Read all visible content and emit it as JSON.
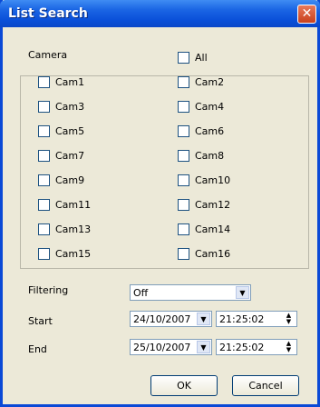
{
  "window": {
    "title": "List Search",
    "close_glyph": "✕"
  },
  "camera": {
    "label": "Camera",
    "all_label": "All",
    "cams": [
      "Cam1",
      "Cam2",
      "Cam3",
      "Cam4",
      "Cam5",
      "Cam6",
      "Cam7",
      "Cam8",
      "Cam9",
      "Cam10",
      "Cam11",
      "Cam12",
      "Cam13",
      "Cam14",
      "Cam15",
      "Cam16"
    ]
  },
  "filtering": {
    "label": "Filtering",
    "value": "Off"
  },
  "start": {
    "label": "Start",
    "date": "24/10/2007",
    "time": "21:25:02"
  },
  "end": {
    "label": "End",
    "date": "25/10/2007",
    "time": "21:25:02"
  },
  "buttons": {
    "ok": "OK",
    "cancel": "Cancel"
  }
}
